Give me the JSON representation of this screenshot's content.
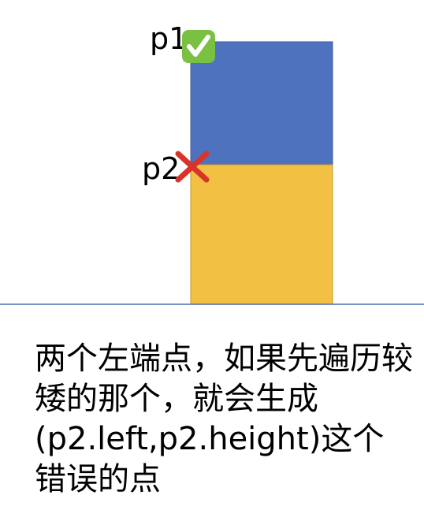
{
  "labels": {
    "p1": "p1",
    "p2": "p2"
  },
  "markers": {
    "p1_icon": "check-mark-icon",
    "p2_icon": "cross-mark-icon"
  },
  "colors": {
    "top_rect": "#4f72be",
    "bottom_rect": "#f2c143",
    "ground_line": "#4a6bb5",
    "check_bg": "#7ac143",
    "cross": "#d9342b"
  },
  "caption": "两个左端点，如果先遍历较矮的那个，就会生成(p2.left,p2.height)这个错误的点"
}
